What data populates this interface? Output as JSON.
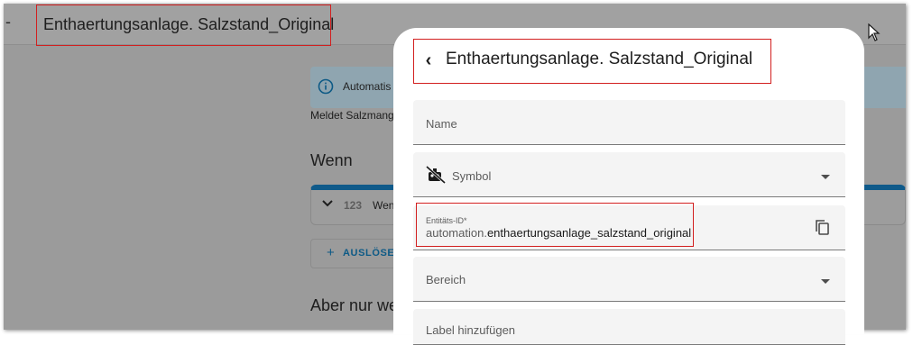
{
  "header": {
    "back_glyph": "-",
    "title": "Enthaertungsanlage. Salzstand_Original"
  },
  "editor": {
    "info_text": "Automatis",
    "description": "Meldet Salzmang",
    "wenn_heading": "Wenn",
    "trigger": {
      "number_badge": "123",
      "label": "Wen"
    },
    "add_trigger": {
      "plus": "+",
      "label": "AUSLÖSE"
    },
    "aber_heading": "Aber nur we"
  },
  "dialog": {
    "back_glyph": "‹",
    "title": "Enthaertungsanlage. Salzstand_Original",
    "name_field": {
      "placeholder": "Name"
    },
    "symbol_field": {
      "placeholder": "Symbol",
      "icon": "robot-off-icon"
    },
    "entity_field": {
      "label": "Entitäts-ID*",
      "domain_prefix": "automation.",
      "object_id": "enthaertungsanlage_salzstand_original",
      "copy_icon": "copy-icon"
    },
    "area_field": {
      "placeholder": "Bereich"
    },
    "next_field": {
      "placeholder": "Label hinzufügen"
    }
  },
  "colors": {
    "highlight_border": "#d21f1f",
    "accent_blue": "#0f5a8a",
    "overlay_gray": "#9b9b9b"
  }
}
